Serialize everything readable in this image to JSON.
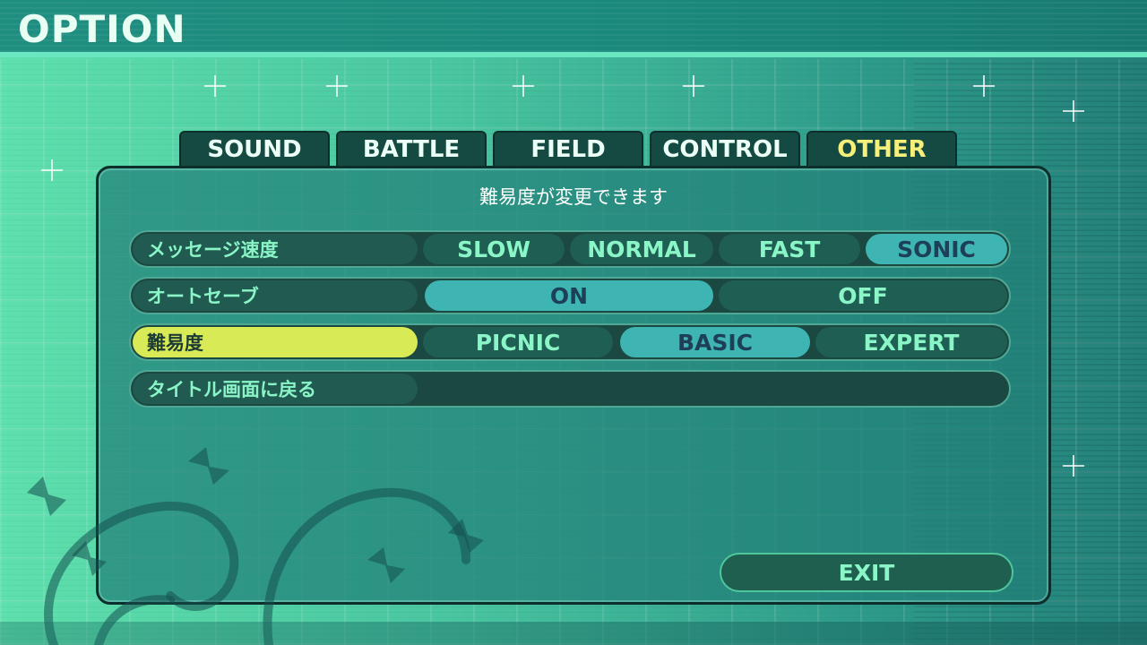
{
  "header": {
    "title": "OPTION"
  },
  "tabs": [
    {
      "label": "SOUND",
      "active": false
    },
    {
      "label": "BATTLE",
      "active": false
    },
    {
      "label": "FIELD",
      "active": false
    },
    {
      "label": "CONTROL",
      "active": false
    },
    {
      "label": "OTHER",
      "active": true
    }
  ],
  "panel": {
    "description": "難易度が変更できます"
  },
  "settings": [
    {
      "label": "メッセージ速度",
      "options": [
        "SLOW",
        "NORMAL",
        "FAST",
        "SONIC"
      ],
      "selected": "SONIC"
    },
    {
      "label": "オートセーブ",
      "options": [
        "ON",
        "OFF"
      ],
      "selected": "ON"
    },
    {
      "label": "難易度",
      "options": [
        "PICNIC",
        "BASIC",
        "EXPERT"
      ],
      "selected": "BASIC",
      "focused": true
    },
    {
      "label": "タイトル画面に戻る"
    }
  ],
  "exit_label": "EXIT",
  "colors": {
    "accent_selected_option": "#3eb5b3",
    "focused_row_label": "#d8ea56",
    "active_tab_text": "#f4f07a",
    "option_text": "#8af5c6"
  }
}
